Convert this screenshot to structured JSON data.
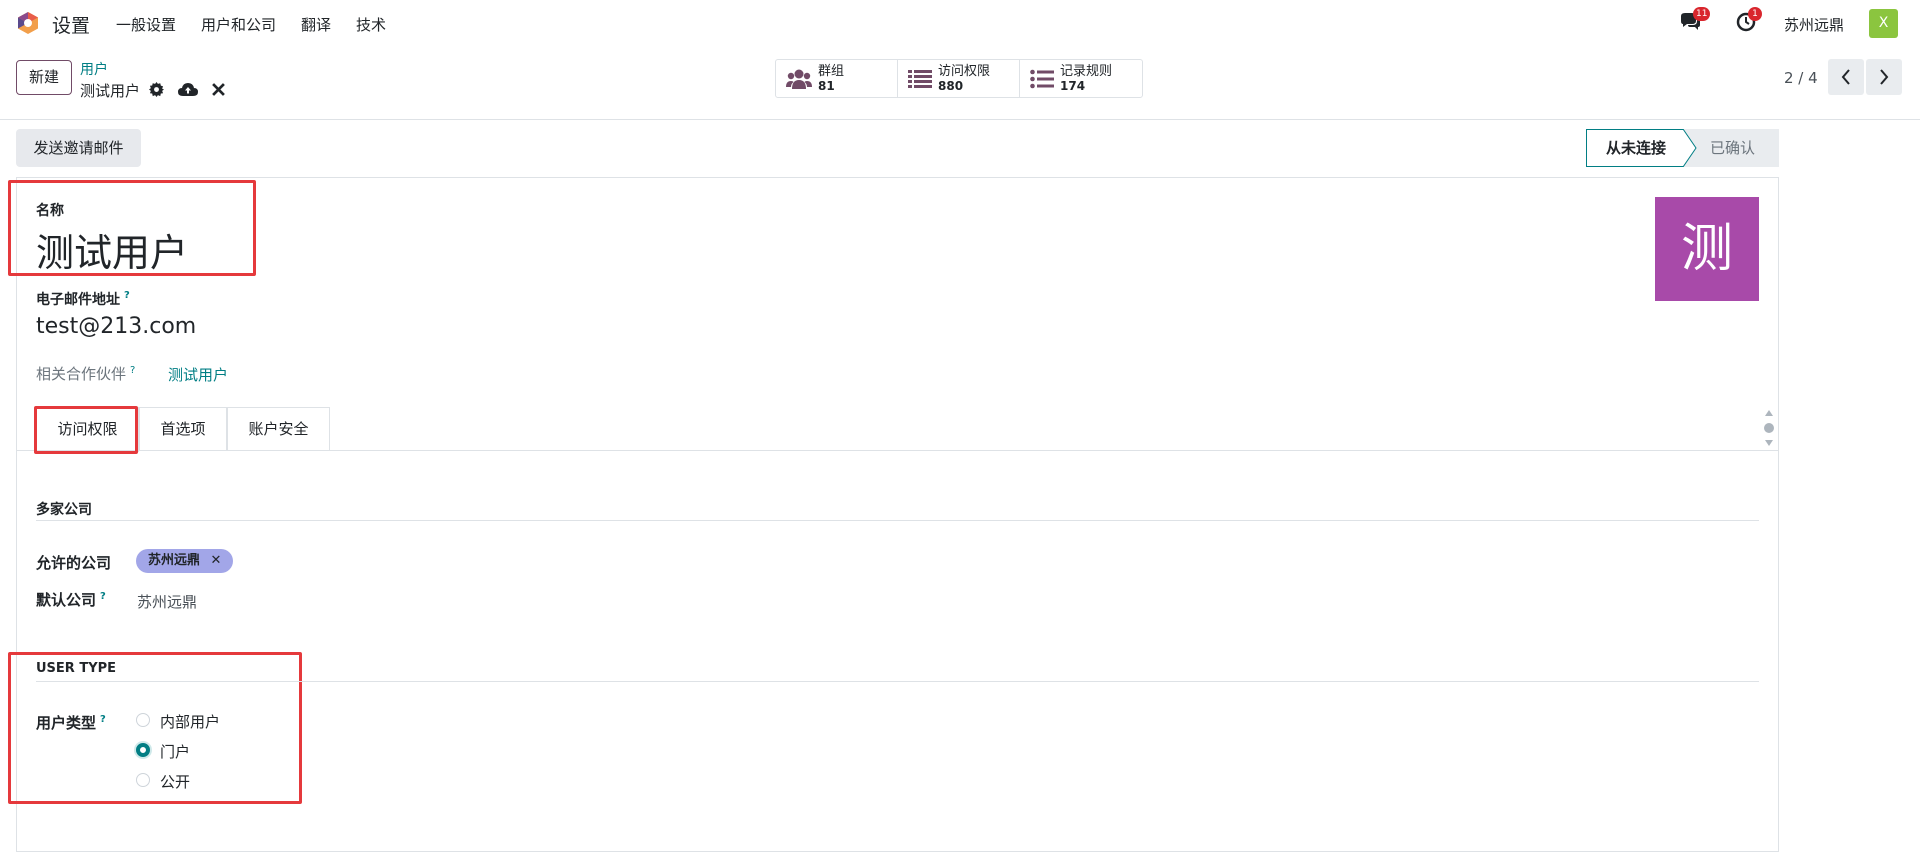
{
  "topbar": {
    "app_name": "设置",
    "menu": [
      "一般设置",
      "用户和公司",
      "翻译",
      "技术"
    ],
    "messages_badge": "11",
    "activity_badge": "1",
    "company": "苏州远鼎",
    "avatar_letter": "X"
  },
  "controlbar": {
    "new_label": "新建",
    "breadcrumb_parent": "用户",
    "breadcrumb_current": "测试用户",
    "smart_buttons": [
      {
        "label": "群组",
        "value": "81"
      },
      {
        "label": "访问权限",
        "value": "880"
      },
      {
        "label": "记录规则",
        "value": "174"
      }
    ],
    "pager": "2 / 4"
  },
  "statusbar": {
    "invite_label": "发送邀请邮件",
    "stage_active": "从未连接",
    "stage_next": "已确认"
  },
  "form": {
    "name_label": "名称",
    "name_value": "测试用户",
    "photo_letter": "测",
    "email_label": "电子邮件地址",
    "email_value": "test@213.com",
    "partner_label": "相关合作伙伴",
    "partner_value": "测试用户",
    "help_mark": "?",
    "tabs": [
      "访问权限",
      "首选项",
      "账户安全"
    ],
    "section_multi_company": "多家公司",
    "allowed_companies_label": "允许的公司",
    "allowed_companies_tag": "苏州远鼎",
    "tag_remove": "✕",
    "default_company_label": "默认公司",
    "default_company_value": "苏州远鼎",
    "section_user_type": "USER TYPE",
    "user_type_label": "用户类型",
    "user_type_options": [
      "内部用户",
      "门户",
      "公开"
    ],
    "user_type_selected": "门户"
  },
  "colors": {
    "accent": "#017e84",
    "primary": "#714b67",
    "highlight": "#e5393c",
    "photo_bg": "#a84aa9",
    "tag_bg": "#a2a6e8",
    "badge": "#d9262d"
  }
}
